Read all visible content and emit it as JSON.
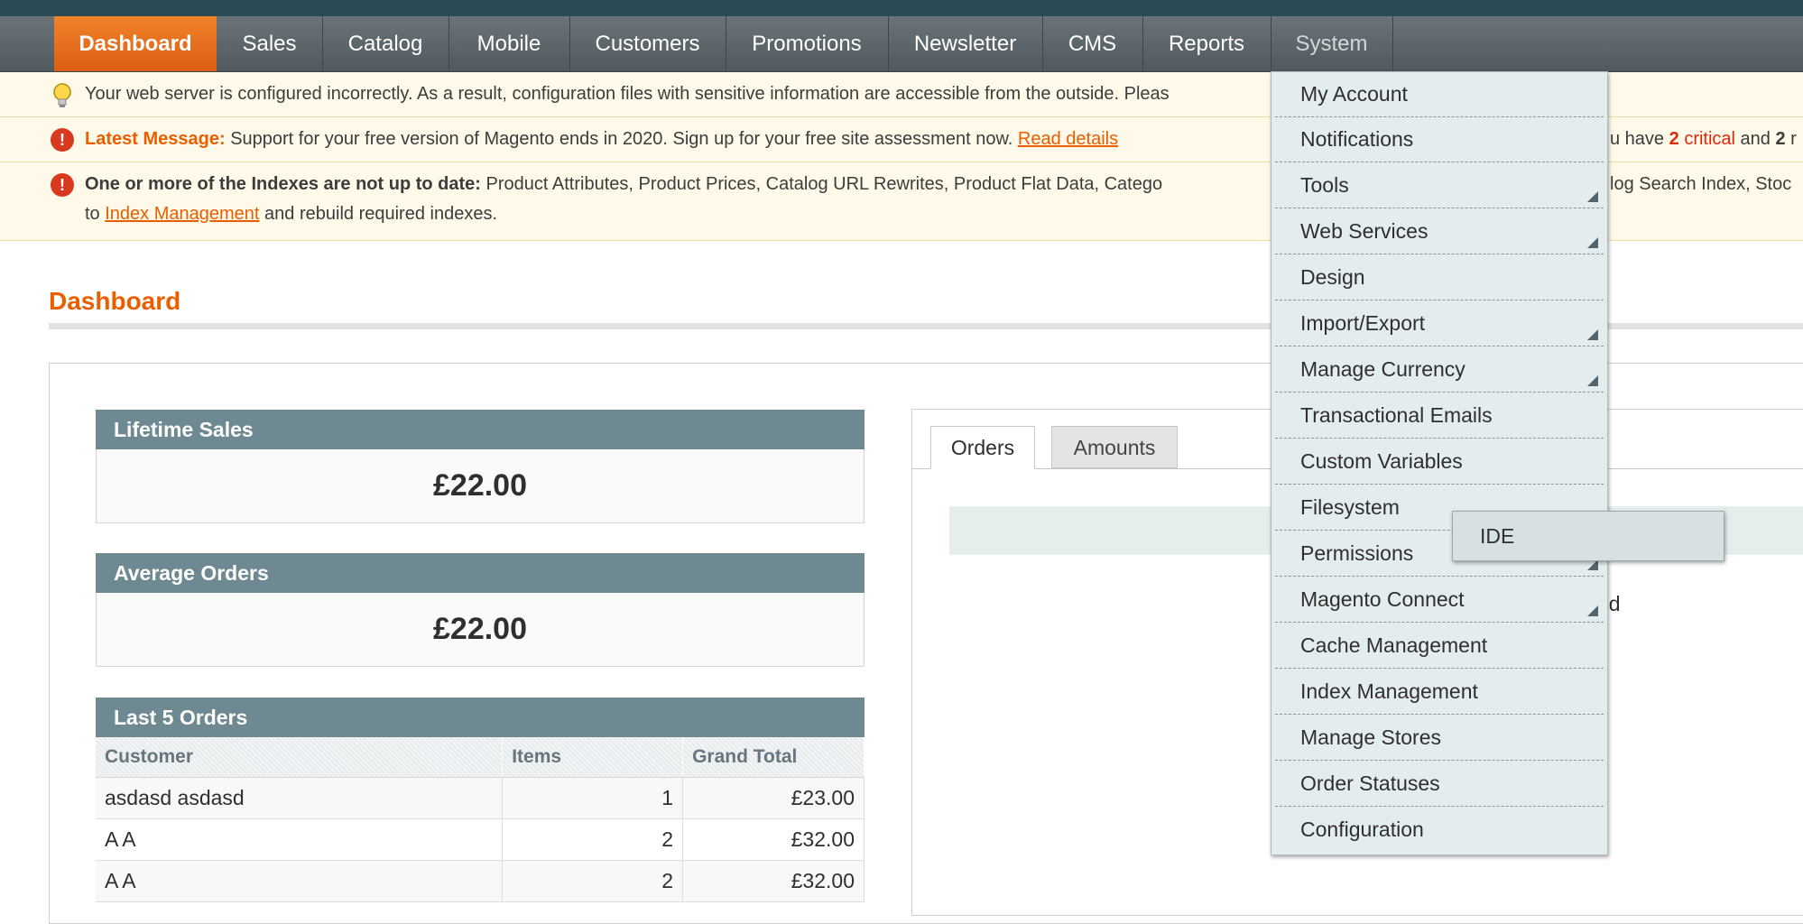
{
  "nav": {
    "items": [
      "Dashboard",
      "Sales",
      "Catalog",
      "Mobile",
      "Customers",
      "Promotions",
      "Newsletter",
      "CMS",
      "Reports",
      "System"
    ],
    "active": "Dashboard",
    "open": "System"
  },
  "messages": {
    "config_warning": "Your web server is configured incorrectly. As a result, configuration files with sensitive information are accessible from the outside. Pleas",
    "latest_label": "Latest Message:",
    "latest_text": "Support for your free version of Magento ends in 2020. Sign up for your free site assessment now.",
    "latest_link": "Read details",
    "latest_tail_prefix": "u have",
    "latest_critical_count": "2",
    "latest_critical_word": "critical",
    "latest_and": "and",
    "latest_tail_count": "2",
    "latest_tail_suffix": "r",
    "index_label": "One or more of the Indexes are not up to date:",
    "index_text": "Product Attributes, Product Prices, Catalog URL Rewrites, Product Flat Data, Catego",
    "index_text_right": "log Search Index, Stoc",
    "index_line2_prefix": "to",
    "index_link": "Index Management",
    "index_line2_suffix": "and rebuild required indexes."
  },
  "page": {
    "title": "Dashboard"
  },
  "lifetime_sales": {
    "label": "Lifetime Sales",
    "value": "£22.00"
  },
  "average_orders": {
    "label": "Average Orders",
    "value": "£22.00"
  },
  "last_orders": {
    "label": "Last 5 Orders",
    "columns": [
      "Customer",
      "Items",
      "Grand Total"
    ],
    "rows": [
      {
        "customer": "asdasd asdasd",
        "items": "1",
        "total": "£23.00"
      },
      {
        "customer": "A A",
        "items": "2",
        "total": "£32.00"
      },
      {
        "customer": "A A",
        "items": "2",
        "total": "£32.00"
      }
    ]
  },
  "chart_tabs": [
    "Orders",
    "Amounts"
  ],
  "chart_partial_text": "nd",
  "system_menu": [
    {
      "label": "My Account",
      "arrow": false
    },
    {
      "label": "Notifications",
      "arrow": false
    },
    {
      "label": "Tools",
      "arrow": true
    },
    {
      "label": "Web Services",
      "arrow": true
    },
    {
      "label": "Design",
      "arrow": false
    },
    {
      "label": "Import/Export",
      "arrow": true
    },
    {
      "label": "Manage Currency",
      "arrow": true
    },
    {
      "label": "Transactional Emails",
      "arrow": false
    },
    {
      "label": "Custom Variables",
      "arrow": false
    },
    {
      "label": "Filesystem",
      "arrow": false
    },
    {
      "label": "Permissions",
      "arrow": true
    },
    {
      "label": "Magento Connect",
      "arrow": true
    },
    {
      "label": "Cache Management",
      "arrow": false
    },
    {
      "label": "Index Management",
      "arrow": false
    },
    {
      "label": "Manage Stores",
      "arrow": false
    },
    {
      "label": "Order Statuses",
      "arrow": false
    },
    {
      "label": "Configuration",
      "arrow": false
    }
  ],
  "filesystem_submenu": {
    "label": "IDE"
  }
}
